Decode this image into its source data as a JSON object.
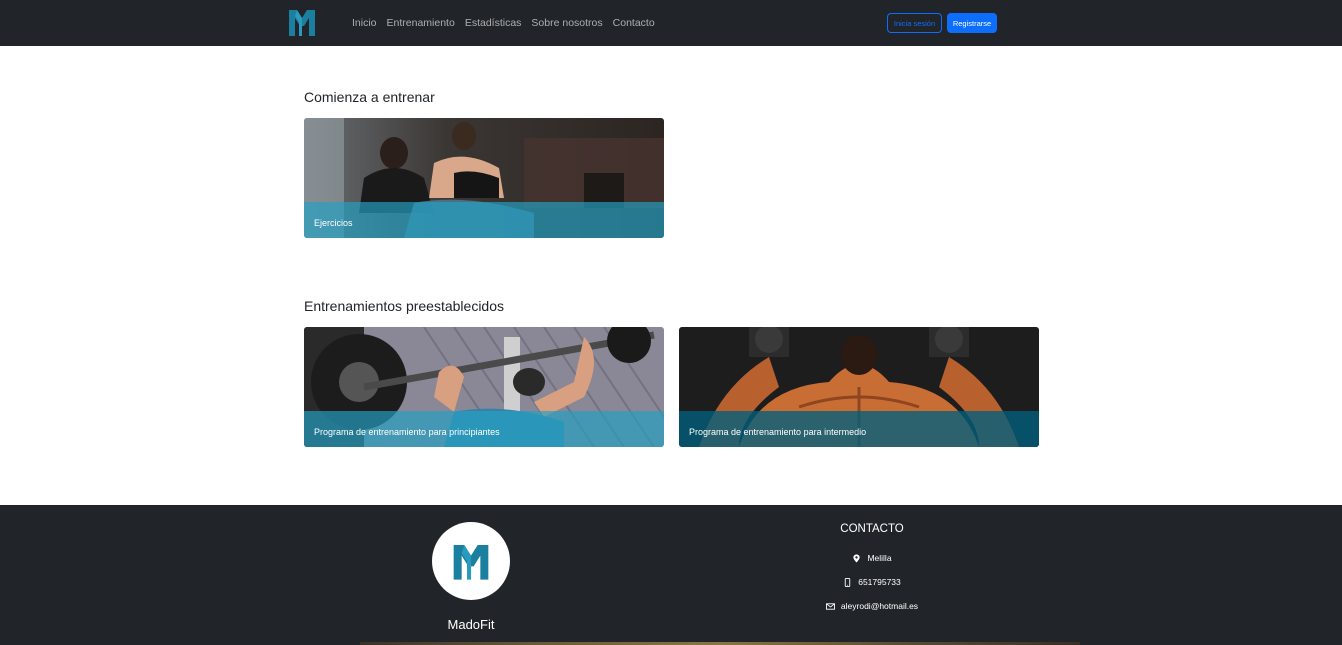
{
  "navbar": {
    "brand_icon": "madofit-logo-icon",
    "links": [
      "Inicio",
      "Entrenamiento",
      "Estadísticas",
      "Sobre nosotros",
      "Contacto"
    ],
    "login_label": "Inicia sesión",
    "register_label": "Registrarse",
    "colors": {
      "background": "#212529",
      "primary": "#0d6efd",
      "brand": "#1b7fa0"
    }
  },
  "start_section": {
    "title": "Comienza a entrenar",
    "cards": [
      {
        "label": "Ejercicios"
      }
    ]
  },
  "preset_section": {
    "title": "Entrenamientos preestablecidos",
    "cards": [
      {
        "label": "Programa de entrenamiento para principiantes"
      },
      {
        "label": "Programa de entrenamiento para intermedio"
      }
    ]
  },
  "footer": {
    "brand_name": "MadoFit",
    "contact_title": "CONTACTO",
    "location": "Melilla",
    "location_icon": "map-pin-icon",
    "phone": "651795733",
    "phone_icon": "phone-icon",
    "email": "aleyrodi@hotmail.es",
    "email_icon": "envelope-icon"
  }
}
